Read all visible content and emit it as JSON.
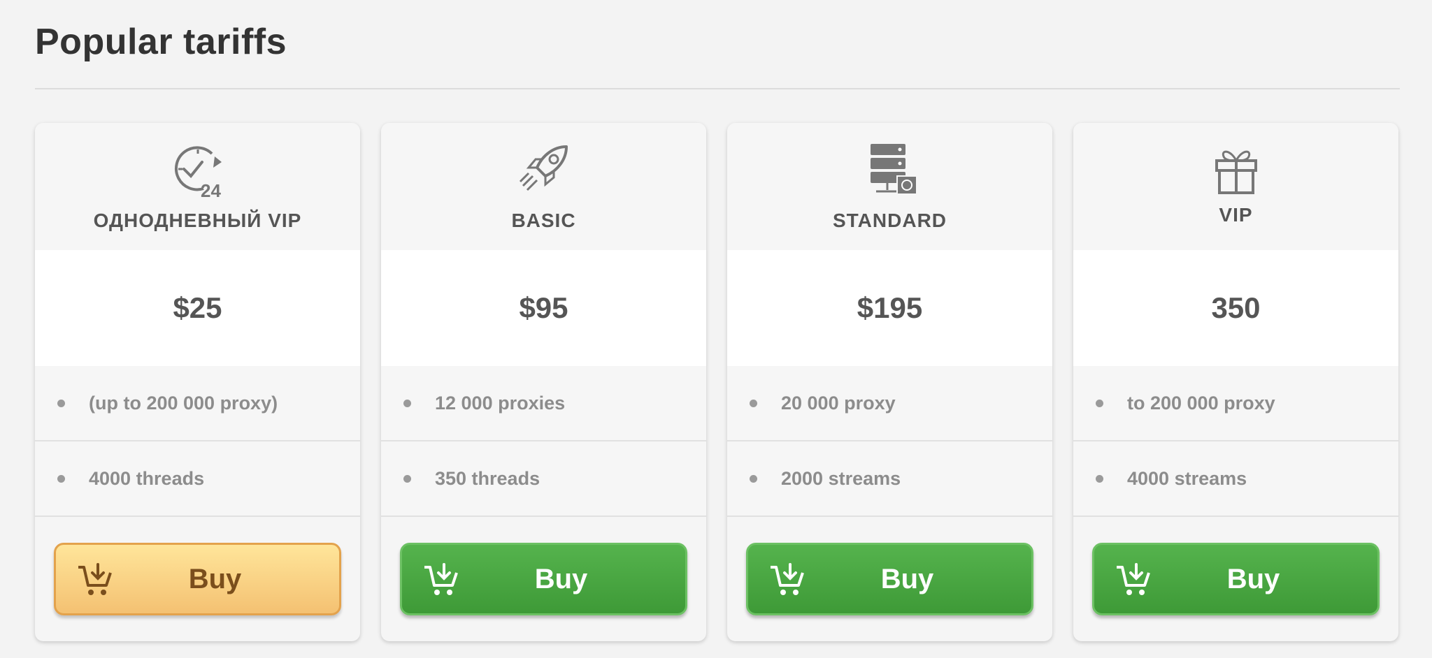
{
  "section": {
    "title": "Popular tariffs"
  },
  "colors": {
    "green_button": "#4aa843",
    "orange_button": "#f8d083",
    "text_dark": "#555555",
    "text_muted": "#8c8c8c"
  },
  "plans": [
    {
      "icon": "clock-24-icon",
      "name": "ОДНОДНЕВНЫЙ VIP",
      "price": "$25",
      "features": [
        "(up to 200 000 proxy)",
        "4000 threads"
      ],
      "buy_label": "Buy",
      "button_style": "orange"
    },
    {
      "icon": "rocket-icon",
      "name": "BASIC",
      "price": "$95",
      "features": [
        "12 000 proxies",
        "350 threads"
      ],
      "buy_label": "Buy",
      "button_style": "green"
    },
    {
      "icon": "server-icon",
      "name": "STANDARD",
      "price": "$195",
      "features": [
        "20 000 proxy",
        "2000 streams"
      ],
      "buy_label": "Buy",
      "button_style": "green"
    },
    {
      "icon": "gift-icon",
      "name": "VIP",
      "price": "350",
      "features": [
        "to 200 000 proxy",
        "4000 streams"
      ],
      "buy_label": "Buy",
      "button_style": "green"
    }
  ]
}
